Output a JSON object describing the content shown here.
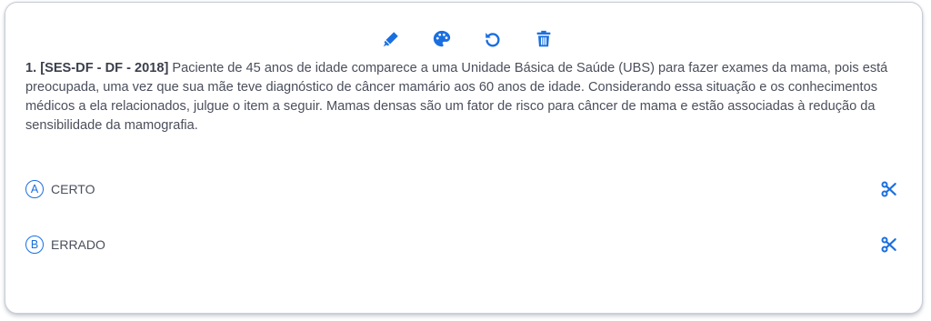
{
  "toolbar": {
    "icons": [
      "highlighter-icon",
      "palette-icon",
      "undo-icon",
      "trash-icon"
    ],
    "accent": "#1a6fe0"
  },
  "question": {
    "number": "1.",
    "source": "[SES-DF - DF - 2018]",
    "text": "Paciente de 45 anos de idade comparece a uma Unidade Básica de Saúde (UBS) para fazer exames da mama, pois está preocupada, uma vez que sua mãe teve diagnóstico de câncer mamário aos 60 anos de idade. Considerando essa situação e os conhecimentos médicos a ela relacionados, julgue o item a seguir. Mamas densas são um fator de risco para câncer de mama e estão associadas à redução da sensibilidade da mamografia."
  },
  "options": [
    {
      "letter": "A",
      "label": "CERTO"
    },
    {
      "letter": "B",
      "label": "ERRADO"
    }
  ]
}
